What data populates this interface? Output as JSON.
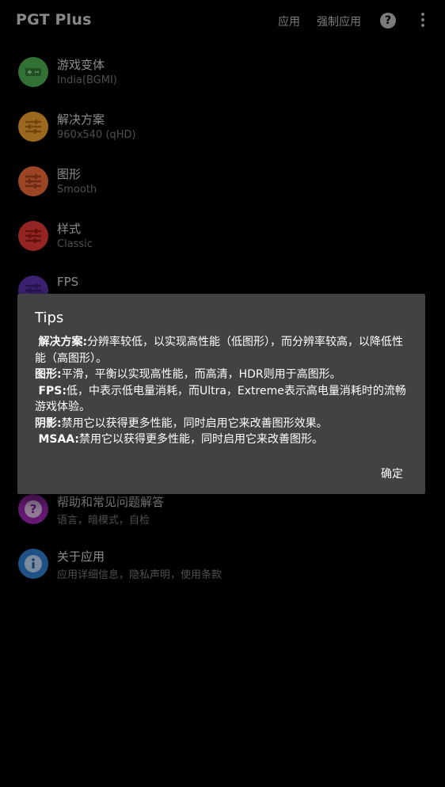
{
  "app": {
    "title": "PGT Plus"
  },
  "toolbar": {
    "apply_label": "应用",
    "force_apply_label": "强制应用",
    "help_glyph": "?"
  },
  "settings": [
    {
      "title": "游戏变体",
      "subtitle": "India(BGMI)",
      "icon": "gamepad-icon",
      "color": "#4caf50"
    },
    {
      "title": "解决方案",
      "subtitle": "960x540 (qHD)",
      "icon": "sliders-icon",
      "color": "#f0a030"
    },
    {
      "title": "图形",
      "subtitle": "Smooth",
      "icon": "sliders-icon",
      "color": "#f06a3a"
    },
    {
      "title": "样式",
      "subtitle": "Classic",
      "icon": "sliders-icon",
      "color": "#e53935"
    },
    {
      "title": "FPS",
      "subtitle": "",
      "icon": "sliders-icon",
      "color": "#5e35b1"
    },
    {
      "title": "帮助和常见问题解答",
      "subtitle": "语言，暗模式，自检",
      "icon": "question-icon",
      "color": "#9c27b0"
    },
    {
      "title": "关于应用",
      "subtitle": "应用详细信息，隐私声明，使用条款",
      "icon": "info-icon",
      "color": "#2f7fd0"
    }
  ],
  "dialog": {
    "title": "Tips",
    "entries": [
      {
        "label": "解决方案:",
        "text": "分辨率较低，以实现高性能（低图形），而分辨率较高，以降低性能（高图形）。"
      },
      {
        "label": "图形:",
        "text": "平滑，平衡以实现高性能，而高清，HDR则用于高图形。"
      },
      {
        "label": "FPS:",
        "text": "低，中表示低电量消耗，而Ultra，Extreme表示高电量消耗时的流畅游戏体验。"
      },
      {
        "label": "阴影:",
        "text": "禁用它以获得更多性能，同时启用它来改善图形效果。"
      },
      {
        "label": "MSAA:",
        "text": "禁用它以获得更多性能，同时启用它来改善图形。"
      }
    ],
    "ok_label": "确定"
  }
}
